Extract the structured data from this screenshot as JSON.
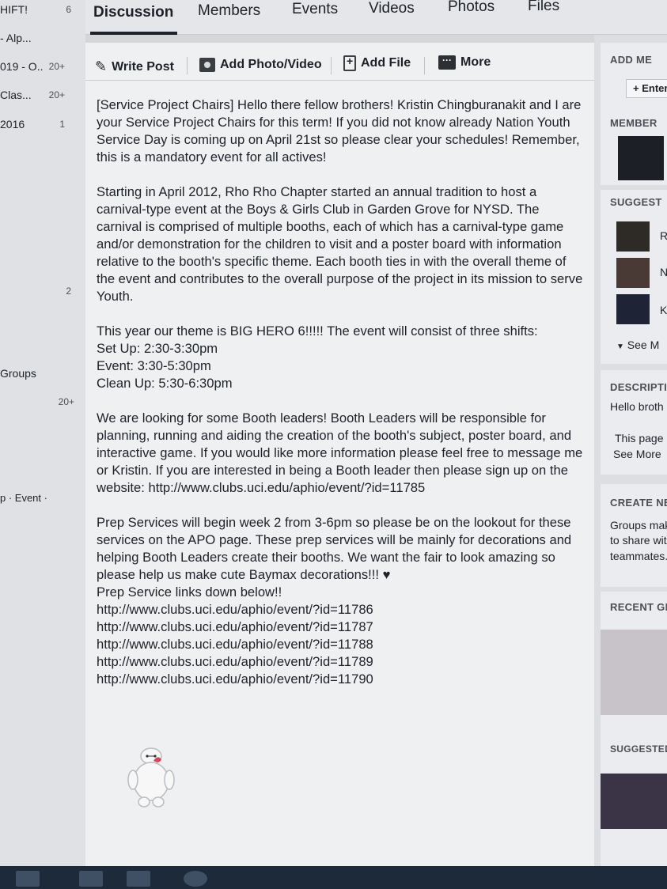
{
  "left_sidebar": {
    "items": [
      {
        "label": "HIFT!",
        "count": "6"
      },
      {
        "label": "- Alp...",
        "count": ""
      },
      {
        "label": "019 - O..",
        "count": "20+"
      },
      {
        "label": "Clas...",
        "count": "20+"
      },
      {
        "label": "2016",
        "count": "1"
      },
      {
        "label": "",
        "count": "2"
      },
      {
        "label": "Groups",
        "count": ""
      },
      {
        "label": "",
        "count": "20+"
      },
      {
        "label": "p · Event ·",
        "count": ""
      }
    ]
  },
  "nav": {
    "tabs": [
      "Discussion",
      "Members",
      "Events",
      "Videos",
      "Photos",
      "Files"
    ],
    "active": "Discussion"
  },
  "composer": {
    "write_post": "Write Post",
    "add_photo": "Add Photo/Video",
    "add_file": "Add File",
    "more": "More"
  },
  "post": {
    "p1": "[Service Project Chairs] Hello there fellow brothers! Kristin Chingburanakit and I are your Service Project Chairs for this term! If you did not know already Nation Youth Service Day is coming up on April 21st so please clear your schedules! Remember, this is a mandatory event for all actives!",
    "p2": "Starting in April 2012, Rho Rho Chapter started an annual tradition to host a carnival-type event at the Boys & Girls Club in Garden Grove for NYSD. The carnival is comprised of multiple booths, each of which has a carnival-type game and/or demonstration for the children to visit and a poster board with information relative to the booth's specific theme. Each booth ties in with the overall theme of the event and contributes to the overall purpose of the project in its mission to serve Youth.",
    "p3": "This year our theme is BIG HERO 6!!!!! The event will consist of three shifts:",
    "shift1": "Set Up: 2:30-3:30pm",
    "shift2": "Event: 3:30-5:30pm",
    "shift3": "Clean Up: 5:30-6:30pm",
    "p4": "We are looking for some Booth leaders! Booth Leaders will be responsible for planning, running and aiding the creation of the booth's subject, poster board, and interactive game. If you would like more information please feel free to message me or Kristin. If you are interested in being a Booth leader then please sign up on the website: http://www.clubs.uci.edu/aphio/event/?id=11785",
    "p5": "Prep Services will begin week 2 from 3-6pm so please be on the lookout for these services on the APO page. These prep services will be mainly for decorations and helping Booth Leaders create their booths. We want the fair to look amazing so please help us make cute Baymax decorations!!! ♥",
    "p6": "Prep Service links down below!!",
    "links": [
      "http://www.clubs.uci.edu/aphio/event/?id=11786",
      "http://www.clubs.uci.edu/aphio/event/?id=11787",
      "http://www.clubs.uci.edu/aphio/event/?id=11788",
      "http://www.clubs.uci.edu/aphio/event/?id=11789",
      "http://www.clubs.uci.edu/aphio/event/?id=11790"
    ]
  },
  "right": {
    "add_members_head": "ADD ME",
    "enter_button": "+ Enter",
    "members_head": "MEMBER",
    "suggested_head": "SUGGEST",
    "suggested": [
      "R",
      "N",
      "Ke"
    ],
    "see_more": "See M",
    "description_head": "DESCRIPTI",
    "description_text1": "Hello broth",
    "description_text2": "This page",
    "description_see_more": "See More",
    "create_head": "CREATE NE",
    "create_text1": "Groups mak",
    "create_text2": "to share wit",
    "create_text3": "teammates.",
    "recent_head": "RECENT GR",
    "suggested2_head": "SUGGESTED"
  },
  "colors": {
    "background": "#d4d6d9",
    "card": "#eef0f2",
    "text": "#1d2129"
  }
}
